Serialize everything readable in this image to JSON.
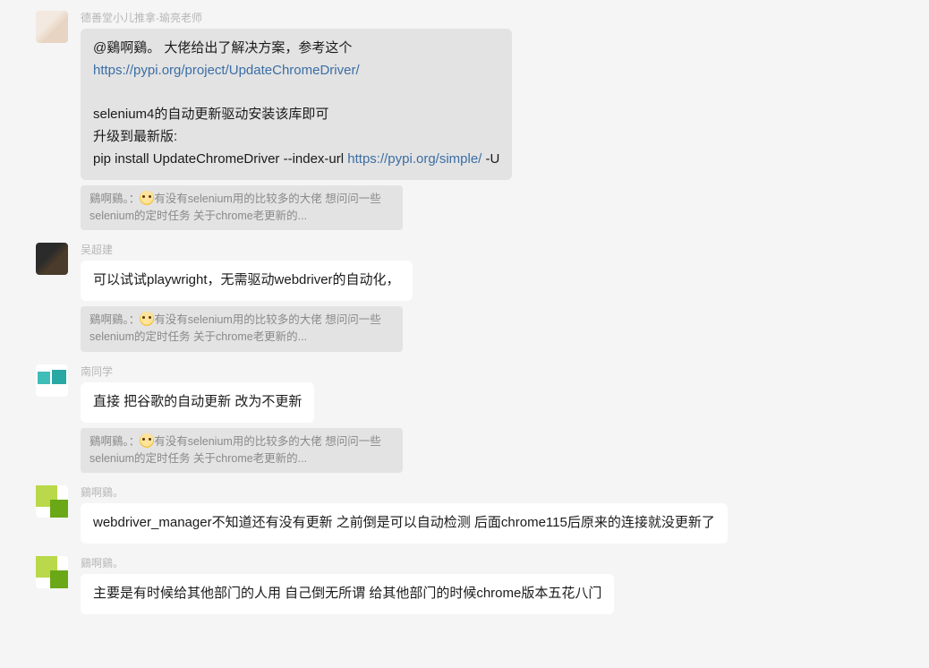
{
  "messages": [
    {
      "name": "德善堂小儿推拿-瑜亮老师",
      "bubble": {
        "line1_pre": "@鷄啊鷄。  大佬给出了解决方案，参考这个",
        "link1": "https://pypi.org/project/UpdateChromeDriver/",
        "line3": "selenium4的自动更新驱动安装该库即可",
        "line4": "升级到最新版:",
        "line5_pre": "pip install UpdateChromeDriver --index-url ",
        "link2": "https://pypi.org/simple/",
        "line5_post": " -U"
      },
      "quote": {
        "name": "鷄啊鷄。",
        "sep": "：",
        "text1": "有没有selenium用的比较多的大佬  想问问一些selenium的定时任务  关于chrome老更新的..."
      }
    },
    {
      "name": "吴超建",
      "bubble": {
        "text": "可以试试playwright，无需驱动webdriver的自动化，"
      },
      "quote": {
        "name": "鷄啊鷄。",
        "sep": "：",
        "text1": "有没有selenium用的比较多的大佬  想问问一些selenium的定时任务  关于chrome老更新的..."
      }
    },
    {
      "name": "南同学",
      "bubble": {
        "text": "直接 把谷歌的自动更新 改为不更新"
      },
      "quote": {
        "name": "鷄啊鷄。",
        "sep": "：",
        "text1": "有没有selenium用的比较多的大佬  想问问一些selenium的定时任务  关于chrome老更新的..."
      }
    },
    {
      "name": "鷄啊鷄。",
      "bubble": {
        "text": "webdriver_manager不知道还有没有更新  之前倒是可以自动检测  后面chrome115后原来的连接就没更新了"
      }
    },
    {
      "name": "鷄啊鷄。",
      "bubble": {
        "text": "主要是有时候给其他部门的人用  自己倒无所谓  给其他部门的时候chrome版本五花八门"
      }
    }
  ]
}
